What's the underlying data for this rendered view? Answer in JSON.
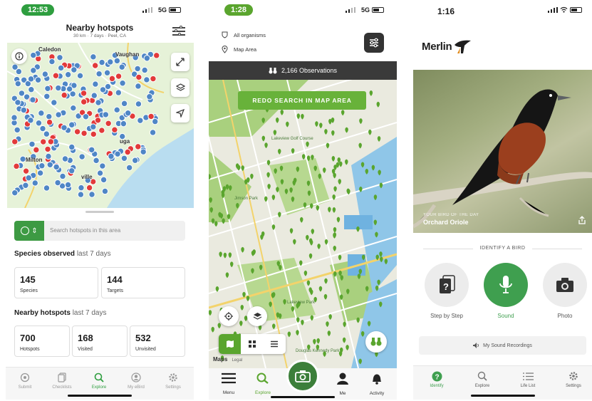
{
  "phone1": {
    "status": {
      "time": "12:53",
      "network": "5G"
    },
    "header": {
      "title": "Nearby hotspots",
      "subtitle": "30 km · 7 days · Peel, CA"
    },
    "map_labels": {
      "caledon": "Caledon",
      "vaughan": "Vaughan",
      "sauga": "uga",
      "milton": "Milton",
      "ville": "ville"
    },
    "search": {
      "placeholder": "Search hotspots in this area"
    },
    "species": {
      "title": "Species observed",
      "period": "last 7 days",
      "stats": [
        {
          "value": "145",
          "label": "Species"
        },
        {
          "value": "144",
          "label": "Targets"
        }
      ]
    },
    "hotspots": {
      "title": "Nearby hotspots",
      "period": "last 7 days",
      "stats": [
        {
          "value": "700",
          "label": "Hotspots"
        },
        {
          "value": "168",
          "label": "Visited"
        },
        {
          "value": "532",
          "label": "Unvisited"
        }
      ]
    },
    "tabs": [
      {
        "label": "Submit",
        "icon": "circle-dot-icon"
      },
      {
        "label": "Checklists",
        "icon": "copy-icon"
      },
      {
        "label": "Explore",
        "icon": "search-icon"
      },
      {
        "label": "My eBird",
        "icon": "person-icon"
      },
      {
        "label": "Settings",
        "icon": "gear-icon"
      }
    ],
    "active_tab": "Explore",
    "colors": {
      "accent": "#2e9e3f",
      "pin_blue": "#4f86c6",
      "pin_red": "#e23a3a",
      "water": "#b9ddf0",
      "land": "#e8f3da"
    }
  },
  "phone2": {
    "status": {
      "time": "1:28",
      "network": "5G"
    },
    "filters": {
      "organisms": "All organisms",
      "area": "Map Area"
    },
    "observations": "2,166 Observations",
    "redo": "REDO SEARCH IN MAP AREA",
    "map_labels": {
      "park1": "Lakeview Golf Course",
      "park2": "Jimson Park",
      "park3": "Lakeview Park",
      "park4": "Douglas Kennedy Park",
      "maps": "Maps",
      "legal": "Legal"
    },
    "tabs": [
      {
        "label": "Menu",
        "icon": "menu-icon"
      },
      {
        "label": "Explore",
        "icon": "search-icon"
      },
      {
        "label": "",
        "icon": "camera-icon"
      },
      {
        "label": "Me",
        "icon": "person-icon"
      },
      {
        "label": "Activity",
        "icon": "bell-icon"
      }
    ],
    "active_tab": "Explore",
    "colors": {
      "accent": "#5aa52e",
      "pin": "#5aa52e",
      "park": "#a9d07e"
    }
  },
  "phone3": {
    "status": {
      "time": "1:16"
    },
    "logo": "Merlin",
    "hero": {
      "kicker": "YOUR BIRD OF THE DAY",
      "bird": "Orchard Oriole"
    },
    "identify_title": "IDENTIFY A BIRD",
    "buttons": [
      {
        "label": "Step by Step",
        "icon": "step-cards-icon"
      },
      {
        "label": "Sound",
        "icon": "microphone-icon"
      },
      {
        "label": "Photo",
        "icon": "camera-icon"
      }
    ],
    "recordings": "My Sound Recordings",
    "tabs": [
      {
        "label": "Identify",
        "icon": "question-icon"
      },
      {
        "label": "Explore",
        "icon": "search-icon"
      },
      {
        "label": "Life List",
        "icon": "list-icon"
      },
      {
        "label": "Settings",
        "icon": "gear-icon"
      }
    ],
    "active_tab": "Identify",
    "colors": {
      "accent": "#3f9f4f"
    }
  }
}
